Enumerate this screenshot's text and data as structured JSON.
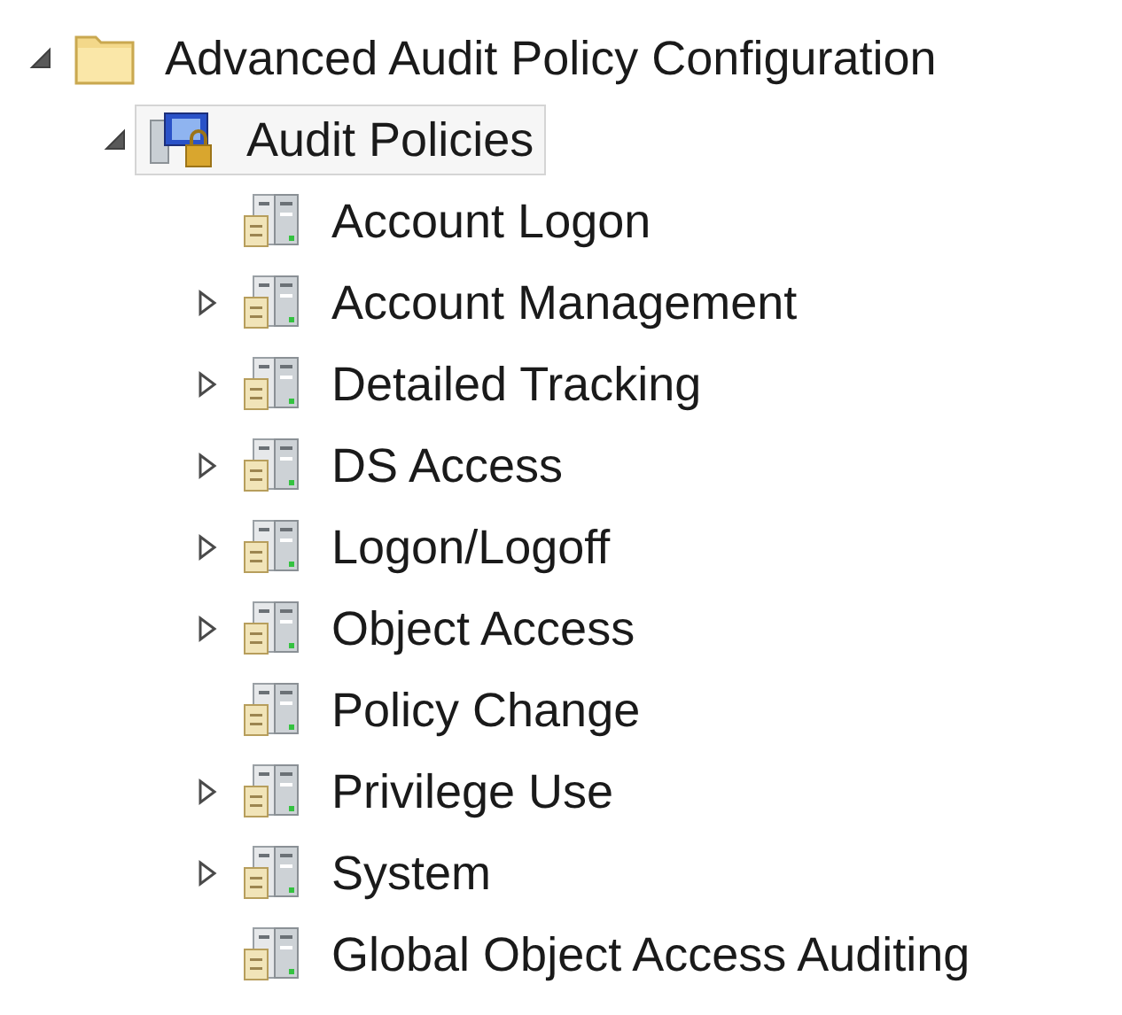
{
  "tree": [
    {
      "label": "Advanced Audit Policy Configuration",
      "kind": "folder",
      "expanded": true,
      "selected": false,
      "children": [
        {
          "label": "Audit Policies",
          "kind": "policy-root",
          "expanded": true,
          "selected": true,
          "children": [
            {
              "label": "Account Logon",
              "kind": "category",
              "selected": false
            },
            {
              "label": "Account Management",
              "kind": "category",
              "expanded": false,
              "selected": false
            },
            {
              "label": "Detailed Tracking",
              "kind": "category",
              "expanded": false,
              "selected": false
            },
            {
              "label": "DS Access",
              "kind": "category",
              "expanded": false,
              "selected": false
            },
            {
              "label": "Logon/Logoff",
              "kind": "category",
              "expanded": false,
              "selected": false
            },
            {
              "label": "Object Access",
              "kind": "category",
              "expanded": false,
              "selected": false
            },
            {
              "label": "Policy Change",
              "kind": "category",
              "selected": false
            },
            {
              "label": "Privilege Use",
              "kind": "category",
              "expanded": false,
              "selected": false
            },
            {
              "label": "System",
              "kind": "category",
              "expanded": false,
              "selected": false
            },
            {
              "label": "Global Object Access Auditing",
              "kind": "category",
              "selected": false
            }
          ]
        }
      ]
    }
  ]
}
